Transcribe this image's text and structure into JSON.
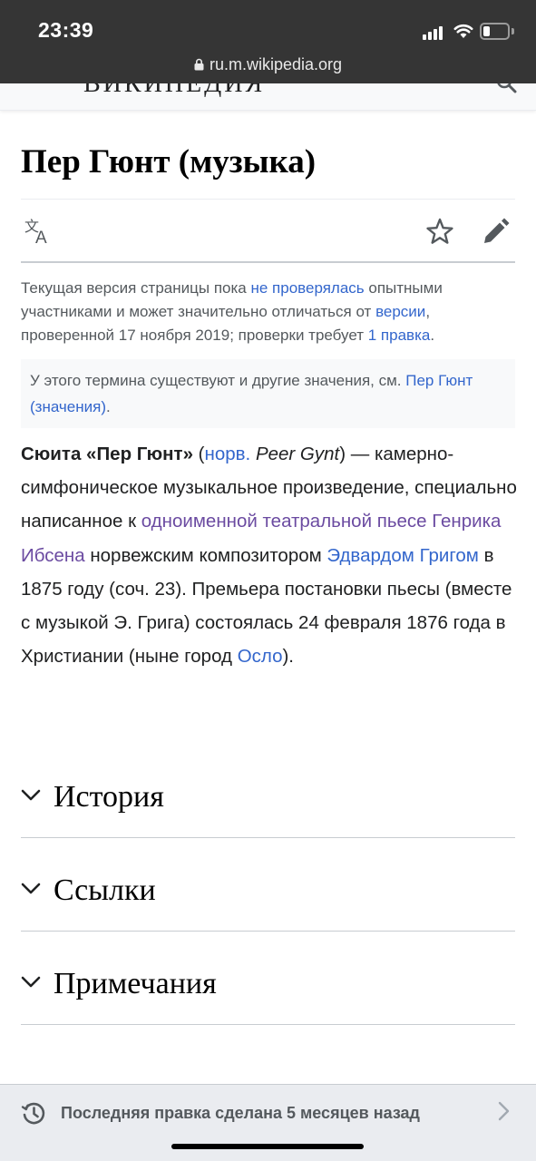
{
  "status_bar": {
    "time": "23:39",
    "url": "ru.m.wikipedia.org"
  },
  "header": {
    "logo_text": "ВИКИПЕДИЯ"
  },
  "article": {
    "title": "Пер Гюнт (музыка)"
  },
  "flagged_revs": {
    "t1": "Текущая версия страницы пока ",
    "link1": "не проверялась",
    "t2": " опытными участниками и может значительно отличаться от ",
    "link2": "версии",
    "t3": ", проверенной 17 ноября 2019; проверки требует ",
    "link3": "1 правка",
    "t4": "."
  },
  "hatnote": {
    "text": "У этого термина существуют и другие значения, см. ",
    "link": "Пер Гюнт (значения)",
    "end": "."
  },
  "lead": {
    "bold": "Сюита «Пер Гюнт»",
    "p1": " (",
    "lang_link": "норв.",
    "p2": " ",
    "orig_title": "Peer Gynt",
    "p3": ") — камерно-симфоническое музыкальное произведение, специально написанное к ",
    "play_link": "одноименной театральной пьесе",
    "p4": " ",
    "ibsen_link": "Генрика Ибсена",
    "p5": " норвежским композитором ",
    "grieg_link": "Эдвардом Григом",
    "p6": " в 1875 году (соч. 23). Премьера постановки пьесы (вместе с музыкой Э. Грига) состоялась 24 февраля 1876 года в Христиании (ныне город ",
    "oslo_link": "Осло",
    "p7": ")."
  },
  "sections": [
    {
      "label": "История"
    },
    {
      "label": "Ссылки"
    },
    {
      "label": "Примечания"
    }
  ],
  "footer": {
    "last_modified": "Последняя правка сделана 5 месяцев назад"
  },
  "colors": {
    "link": "#3366cc",
    "visited_link": "#6b4ba1",
    "status_bar": "#353535"
  },
  "icons": [
    "lock-icon",
    "cellular-signal-icon",
    "wifi-icon",
    "battery-icon",
    "language-icon",
    "star-icon",
    "edit-pencil-icon",
    "chevron-down-icon",
    "history-clock-icon",
    "chevron-right-icon"
  ]
}
